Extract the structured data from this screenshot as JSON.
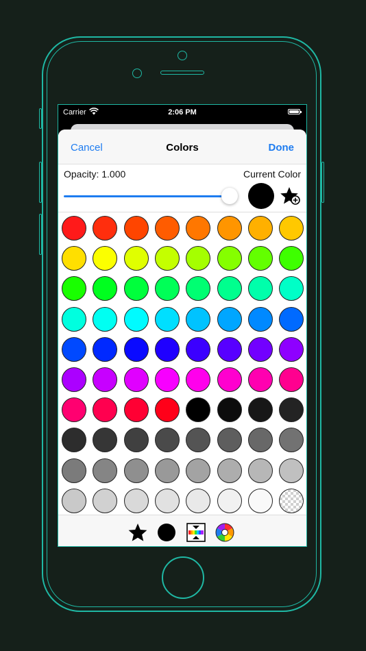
{
  "status": {
    "carrier": "Carrier",
    "time": "2:06 PM"
  },
  "nav": {
    "cancel": "Cancel",
    "title": "Colors",
    "done": "Done"
  },
  "controls": {
    "opacity_label": "Opacity: 1.000",
    "opacity_value": 1.0,
    "current_color_label": "Current Color",
    "current_color": "#000000"
  },
  "colors": {
    "accent": "#1e7cf0",
    "device_outline": "#1fb8a4"
  },
  "palette": [
    [
      "#ff1a1a",
      "#ff2e0d",
      "#ff4500",
      "#ff5c00",
      "#ff7700",
      "#ff9500",
      "#ffb000",
      "#ffc800"
    ],
    [
      "#ffdf00",
      "#fbff00",
      "#e0ff00",
      "#c4ff00",
      "#a5ff00",
      "#85ff00",
      "#63ff00",
      "#3eff00"
    ],
    [
      "#19ff00",
      "#00ff1f",
      "#00ff3c",
      "#00ff57",
      "#00ff72",
      "#00ff8e",
      "#00ffab",
      "#00ffc7"
    ],
    [
      "#00ffdf",
      "#00fff2",
      "#00fbff",
      "#00dfff",
      "#00c3ff",
      "#00a6ff",
      "#0089ff",
      "#006aff"
    ],
    [
      "#0049ff",
      "#0029ff",
      "#0a0aff",
      "#1f00ff",
      "#3b00ff",
      "#5700ff",
      "#7200ff",
      "#8e00ff"
    ],
    [
      "#ab00ff",
      "#c700ff",
      "#e000ff",
      "#f700ff",
      "#ff00ec",
      "#ff00cf",
      "#ff00b0",
      "#ff008f"
    ],
    [
      "#ff0070",
      "#ff004f",
      "#ff0033",
      "#ff0019",
      "#000000",
      "#0c0c0c",
      "#171717",
      "#232323"
    ],
    [
      "#2d2d2d",
      "#363636",
      "#404040",
      "#4a4a4a",
      "#545454",
      "#5e5e5e",
      "#686868",
      "#727272"
    ],
    [
      "#7b7b7b",
      "#858585",
      "#8f8f8f",
      "#999999",
      "#a3a3a3",
      "#adadad",
      "#b7b7b7",
      "#c0c0c0"
    ],
    [
      "#c9c9c9",
      "#d1d1d1",
      "#d9d9d9",
      "#e1e1e1",
      "#e9e9e9",
      "#f1f1f1",
      "#f9f9f9",
      "clear"
    ]
  ],
  "toolbar": {
    "items": [
      {
        "name": "favorites-star-icon"
      },
      {
        "name": "current-color-icon"
      },
      {
        "name": "spectrum-icon"
      },
      {
        "name": "color-wheel-icon"
      }
    ]
  }
}
